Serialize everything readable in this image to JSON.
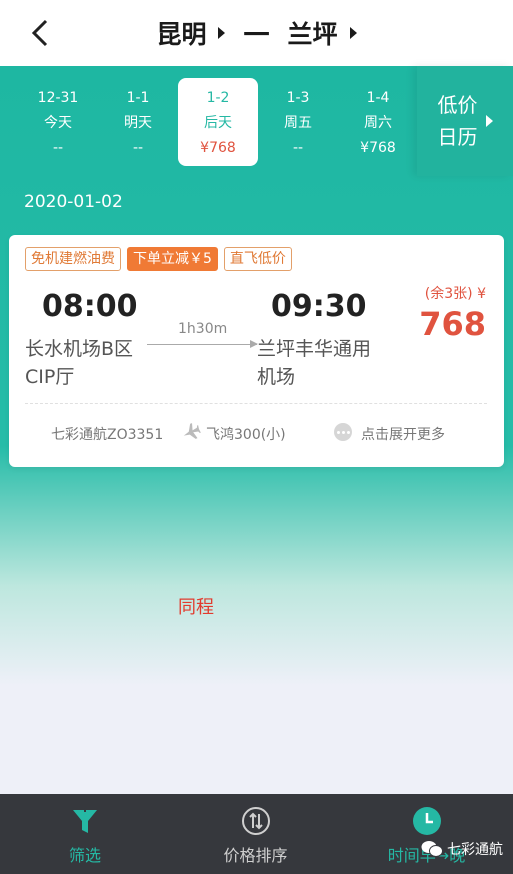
{
  "header": {
    "origin": "昆明",
    "separator": "一",
    "destination": "兰坪"
  },
  "dates": [
    {
      "date": "12-31",
      "label": "今天",
      "price": "--",
      "active": false
    },
    {
      "date": "1-1",
      "label": "明天",
      "price": "--",
      "active": false
    },
    {
      "date": "1-2",
      "label": "后天",
      "price": "¥768",
      "active": true
    },
    {
      "date": "1-3",
      "label": "周五",
      "price": "--",
      "active": false
    },
    {
      "date": "1-4",
      "label": "周六",
      "price": "¥768",
      "active": false
    }
  ],
  "calendar": {
    "line1": "低价",
    "line2": "日历"
  },
  "selected_date": "2020-01-02",
  "flight": {
    "tags": [
      "免机建燃油费",
      "下单立减￥5",
      "直飞低价"
    ],
    "dep_time": "08:00",
    "arr_time": "09:30",
    "duration": "1h30m",
    "dep_airport": "长水机场B区CIP厅",
    "arr_airport": "兰坪丰华通用机场",
    "remaining": "(余3张) ¥",
    "price": "768",
    "airline": "七彩通航ZO3351",
    "aircraft": "飞鸿300(小)",
    "expand": "点击展开更多"
  },
  "overlay_text": "同程",
  "tabbar": {
    "filter": "筛选",
    "price_sort": "价格排序",
    "time_sort": "时间早→晚"
  },
  "watermark": "七彩通航",
  "colors": {
    "teal": "#25b8a4",
    "price_red": "#e0533f",
    "tag_orange": "#f07a35",
    "tabbar_bg": "#36383d"
  }
}
